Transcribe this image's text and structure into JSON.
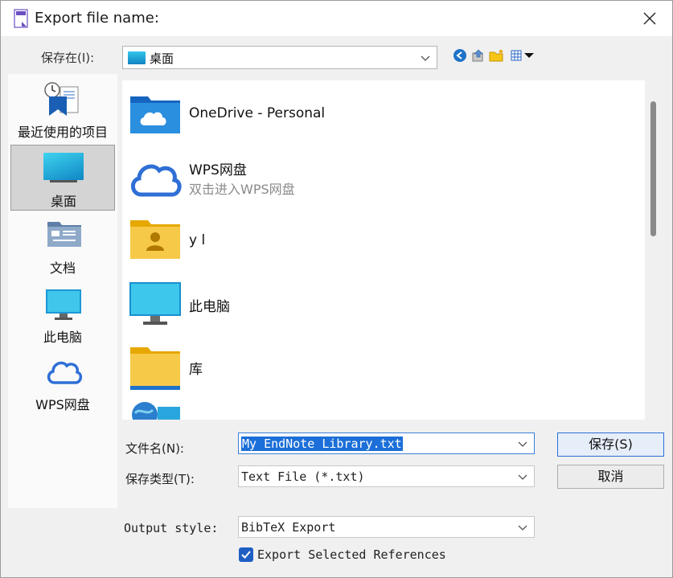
{
  "window": {
    "title": "Export file name:"
  },
  "save_in": {
    "label": "保存在(I):",
    "value": "桌面"
  },
  "toolbar": {
    "back_icon": "back-icon",
    "up_icon": "up-folder-icon",
    "new_folder_icon": "new-folder-icon",
    "view_icon": "view-menu-icon"
  },
  "places": [
    {
      "label": "最近使用的项目",
      "icon": "recent-items-icon"
    },
    {
      "label": "桌面",
      "icon": "desktop-icon",
      "selected": true
    },
    {
      "label": "文档",
      "icon": "documents-icon"
    },
    {
      "label": "此电脑",
      "icon": "this-pc-icon"
    },
    {
      "label": "WPS网盘",
      "icon": "wps-cloud-icon"
    }
  ],
  "files": [
    {
      "name": "OneDrive - Personal",
      "icon": "onedrive-folder-icon"
    },
    {
      "name": "WPS网盘",
      "subtitle": "双击进入WPS网盘",
      "icon": "wps-cloud-icon"
    },
    {
      "name": "y l",
      "icon": "user-folder-icon"
    },
    {
      "name": "此电脑",
      "icon": "monitor-icon"
    },
    {
      "name": "库",
      "icon": "library-folder-icon"
    },
    {
      "name": "",
      "icon": "network-icon"
    }
  ],
  "form": {
    "filename_label": "文件名(N):",
    "filename_value": "My EndNote Library.txt",
    "filetype_label": "保存类型(T):",
    "filetype_value": "Text File (*.txt)",
    "output_style_label": "Output style:",
    "output_style_value": "BibTeX Export",
    "export_selected_label": "Export Selected References",
    "export_selected_checked": true
  },
  "buttons": {
    "save": "保存(S)",
    "cancel": "取消"
  },
  "colors": {
    "accent": "#1f5fc4",
    "selection": "#1c6fd8",
    "folder_yellow": "#f5c518"
  }
}
